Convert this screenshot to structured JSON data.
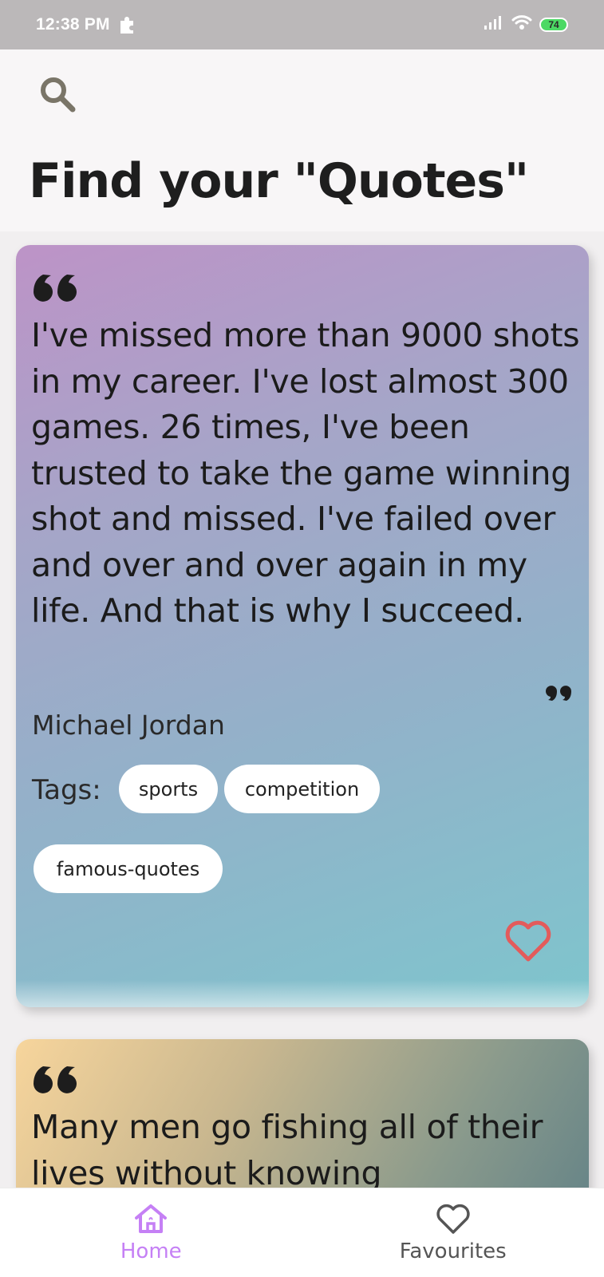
{
  "status_bar": {
    "time": "12:38 PM",
    "battery": "74",
    "icons": [
      "extension-icon",
      "signal-icon",
      "wifi-icon",
      "battery-icon"
    ]
  },
  "header": {
    "search_icon": "search-icon",
    "title": "Find your \"Quotes\""
  },
  "quotes": [
    {
      "text": "I've missed more than 9000 shots in my career. I've lost almost 300 games. 26 times, I've been trusted to take the game winning shot and missed. I've failed over and over and over again in my life. And that is why I succeed.",
      "author": "Michael Jordan",
      "tags_label": "Tags:",
      "tags": [
        "sports",
        "competition",
        "famous-quotes"
      ],
      "favourite_icon": "heart-outline-icon",
      "favourite_color": "#e35b5b"
    },
    {
      "text": "Many men go fishing all of their lives without knowing"
    }
  ],
  "bottom_nav": {
    "items": [
      {
        "label": "Home",
        "icon": "home-icon",
        "active": true,
        "color": "#c580f5"
      },
      {
        "label": "Favourites",
        "icon": "heart-outline-icon",
        "active": false,
        "color": "#555555"
      }
    ]
  }
}
